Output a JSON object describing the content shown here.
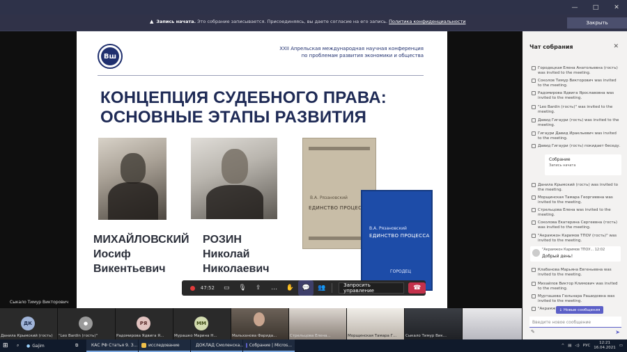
{
  "window": {
    "controls": [
      "—",
      "□",
      "✕"
    ]
  },
  "banner": {
    "bold": "Запись начата.",
    "text": " Это собрание записывается. Присоединяясь, вы даете согласие на его запись.",
    "link": "Политика конфиденциальности",
    "button": "Закрыть"
  },
  "slide": {
    "logo_text": "Вш",
    "conference_line1": "XXII Апрельская международная научная конференция",
    "conference_line2": "по проблемам развития экономики и общества",
    "title_line1": "КОНЦЕПЦИЯ СУДЕБНОГО ПРАВА:",
    "title_line2": "ОСНОВНЫЕ ЭТАПЫ РАЗВИТИЯ",
    "person1": {
      "line1": "МИХАЙЛОВСКИЙ",
      "line2": "Иосиф",
      "line3": "Викентьевич"
    },
    "person2": {
      "line1": "РОЗИН",
      "line2": "Николай",
      "line3": "Николаевич"
    },
    "book1": {
      "author": "В.А. Рязановский",
      "title": "ЕДИНСТВО ПРОЦЕССА"
    },
    "book2": {
      "author": "В.А. Рязановский",
      "title": "ЕДИНСТВО ПРОЦЕССА",
      "publisher": "ГОРОДЕЦ"
    }
  },
  "self_label": "Сыкало Тимур Викторович",
  "toolbar": {
    "timer": "47:52",
    "request_control": "Запросить управление",
    "icons": [
      "record-indicator-icon",
      "camera-icon",
      "mic-icon",
      "share-icon",
      "more-icon",
      "raise-hand-icon",
      "chat-icon",
      "participants-icon",
      "hang-up-icon"
    ]
  },
  "participants": [
    {
      "initials": "ДК",
      "name": "Данила Крымский (гость)",
      "color": "#a0b4d8"
    },
    {
      "initials": "",
      "name": "\"Leo Bardin (гость)\"",
      "color": "#9a9a9a"
    },
    {
      "initials": "РЯ",
      "name": "Радомирова Ядвига Я...",
      "color": "#e2c3c0"
    },
    {
      "initials": "ММ",
      "name": "Мурашко Марина Н...",
      "color": "#d3dcb0"
    },
    {
      "initials": "",
      "name": "Мальханова Фарида...",
      "color": ""
    },
    {
      "initials": "",
      "name": "Стрельцова Елена...",
      "color": ""
    },
    {
      "initials": "",
      "name": "Морщинская Тамара Г...",
      "color": ""
    },
    {
      "initials": "",
      "name": "Сыкало Тимур Вик...",
      "color": ""
    },
    {
      "initials": "",
      "name": "",
      "color": ""
    }
  ],
  "chat": {
    "header": "Чат собрания",
    "events_top": [
      "Городецкая Елена Анатольевна (гость) was invited to the meeting.",
      "Соколов Тимур Викторович was invited to the meeting.",
      "Радомирова Ядвига Ярославовна was invited to the meeting.",
      "\"Leo Bardin (гость)\" was invited to the meeting.",
      "Давид Гигаури (гость) was invited to the meeting.",
      "Гигаури Давид Иракльевич was invited to the meeting.",
      "Давид Гигаури (гость) покидает беседу."
    ],
    "card_title": "Собрание",
    "card_sub": "Запись начата",
    "events_bottom": [
      "Данила Крымский (гость) was invited to the meeting.",
      "Морщинская Тамара Георгиевна was invited to the meeting.",
      "Стрельцова Елена was invited to the meeting.",
      "Соколова Екатерина Сергеевна (гость) was invited to the meeting.",
      "\"Акрамжон Каримов ТПОУ (гость)\" was invited to the meeting."
    ],
    "message_sender": "\"Акрамжон Каримов ТПОУ...   12:02",
    "message_text": "Добрый день!",
    "events_after": [
      "Клабанова Марьяна Евгеньевна was invited to the meeting.",
      "Михайлов Виктор Климович was invited to the meeting.",
      "Мурташева Гюльнара Рашидовна was invited to the meeting.",
      "\"Акрамжон Каримов...\""
    ],
    "new_messages": "Новые сообщения",
    "input_placeholder": "Введите новое сообщение"
  },
  "taskbar": {
    "search": "Gajim",
    "apps": [
      {
        "label": "КАС РФ Статья 9. З...",
        "color": "#e66000"
      },
      {
        "label": "исследование",
        "color": "#f0c04a"
      },
      {
        "label": "ДОКЛАД Смоленска...",
        "color": "#2b5797"
      },
      {
        "label": "Собрание | Micros...",
        "color": "#5b5fc7"
      }
    ],
    "tray_lang": "РУС",
    "time": "12:21",
    "date": "16.04.2021"
  }
}
